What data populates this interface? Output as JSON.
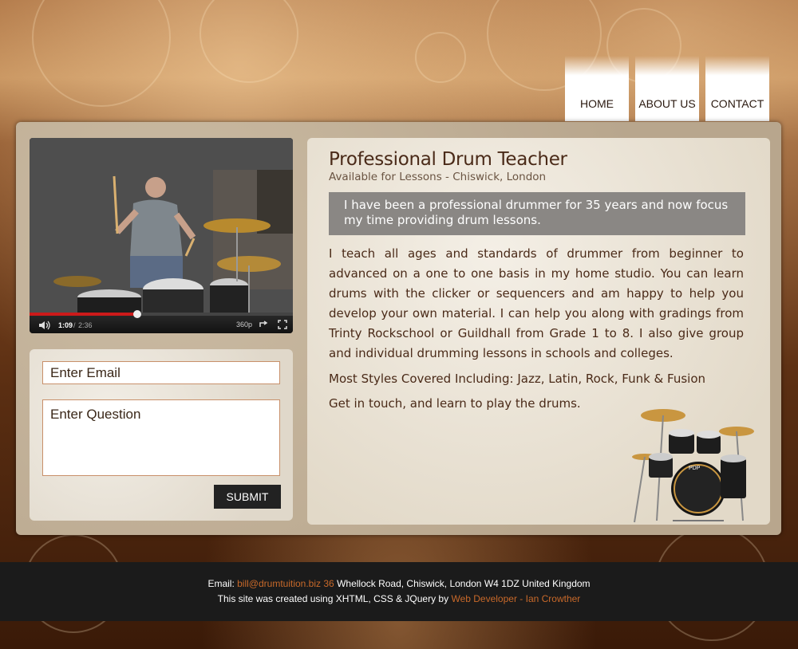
{
  "nav": {
    "home": "HOME",
    "about": "ABOUT US",
    "contact": "CONTACT"
  },
  "video": {
    "current_time": "1:09",
    "duration": "2:36",
    "separator": "/",
    "quality": "360p",
    "progress": 0.41,
    "icons": [
      "volume-icon",
      "loop-icon",
      "fullscreen-icon"
    ]
  },
  "form": {
    "email_placeholder": "Enter Email",
    "question_placeholder": "Enter Question",
    "submit_label": "SUBMIT"
  },
  "main": {
    "title": "Professional Drum Teacher",
    "subtitle": "Available for Lessons - Chiswick, London",
    "highlight": "I have been a professional drummer for 35 years and now focus my time providing drum lessons.",
    "paragraph1": "I teach all ages and standards of drummer from beginner to advanced on a one to one basis in my home studio. You can learn drums with the clicker or sequencers and am happy to help you develop your own material. I can help you along with gradings from Trinty Rockschool or Guildhall from Grade 1 to 8. I also give group and individual drumming lessons in schools and colleges.",
    "paragraph2": "Most Styles Covered Including: Jazz, Latin, Rock, Funk & Fusion",
    "paragraph3": "Get in touch, and learn to play the drums."
  },
  "footer": {
    "email_label": "Email:",
    "email": "bill@drumtuition.biz",
    "address_number": "36",
    "address": "Whellock Road, Chiswick, London W4 1DZ United Kingdom",
    "credit_text": "This site was created using XHTML, CSS & JQuery by",
    "credit_link": "Web Developer - Ian Crowther"
  },
  "colors": {
    "accent": "#c8692a",
    "footer_bg": "#1b1b1b",
    "highlight_bg": "#8a8784",
    "text": "#4a2a18"
  }
}
